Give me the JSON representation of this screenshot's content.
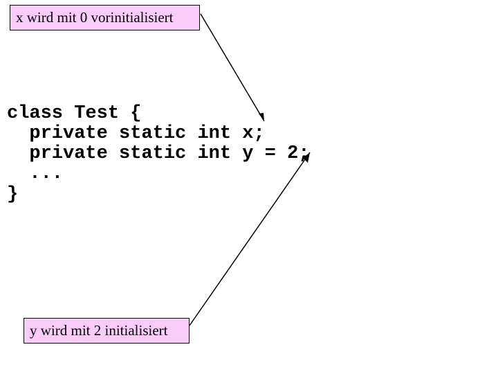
{
  "annotations": {
    "top": "x wird mit 0 vorinitialisiert",
    "bottom": "y wird mit 2 initialisiert"
  },
  "code": {
    "line1": "class Test {",
    "line2": "  private static int x;",
    "line3": "  private static int y = 2;",
    "line4": "  ...",
    "line5": "}"
  }
}
